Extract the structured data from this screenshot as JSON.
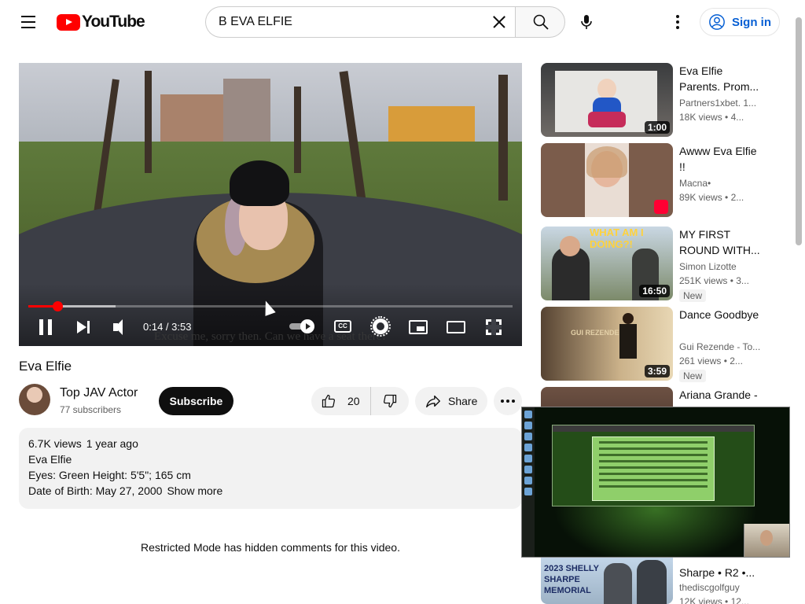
{
  "header": {
    "logo_text": "YouTube",
    "search_value": "B EVA ELFIE",
    "signin_label": "Sign in"
  },
  "player": {
    "caption": "Excuse me, sorry then. Can we have a seat there?",
    "time_display": "0:14 / 3:53",
    "progress_played_fraction": 0.06,
    "progress_buffered_fraction": 0.18,
    "cc_label": "CC"
  },
  "video": {
    "title": "Eva Elfie",
    "channel_name": "Top JAV Actor",
    "subscriber_count": "77 subscribers",
    "subscribe_label": "Subscribe",
    "like_count": "20",
    "share_label": "Share",
    "description": {
      "views": "6.7K views",
      "age": "1 year ago",
      "lines": [
        "Eva Elfie",
        "Eyes: Green Height: 5'5\"; 165 cm",
        "Date of Birth: May 27, 2000"
      ],
      "show_more": "Show more"
    },
    "comments_note": "Restricted Mode has hidden comments for this video."
  },
  "recommendations": [
    {
      "title": "Eva Elfie Parents. Prom...",
      "channel": "Partners1xbet. 1...",
      "views": "18K views",
      "age": "• 4...",
      "duration": "1:00",
      "badge": ""
    },
    {
      "title": "Awww Eva Elfie !!",
      "channel": "Macna•",
      "views": "89K views",
      "age": "• 2...",
      "duration": "",
      "badge": ""
    },
    {
      "title": "MY FIRST ROUND WITH...",
      "channel": "Simon Lizotte",
      "views": "251K views",
      "age": "• 3...",
      "duration": "16:50",
      "badge": "New",
      "thumb_text": "WHAT AM I DOING?!"
    },
    {
      "title": "Dance Goodbye",
      "channel": "Gui Rezende - To...",
      "views": "261 views",
      "age": "• 2...",
      "duration": "3:59",
      "badge": "New",
      "thumb_text": "GUI REZENDE"
    },
    {
      "title": "Ariana Grande -",
      "channel": "",
      "views": "",
      "age": "",
      "duration": "",
      "badge": ""
    },
    {
      "title": "Sharpe • R2 •...",
      "channel": "thediscgolfguy",
      "views": "12K views",
      "age": "• 12...",
      "duration": "",
      "badge": "",
      "thumb_text": "2023 SHELLY SHARPE MEMORIAL"
    }
  ]
}
